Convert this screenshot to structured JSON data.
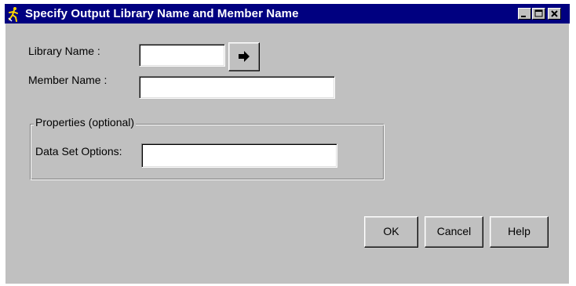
{
  "window": {
    "title": "Specify Output Library Name and Member Name",
    "title_icon": "sas-runner-icon",
    "controls": [
      "minimize-icon",
      "maximize-icon",
      "close-icon"
    ]
  },
  "form": {
    "library_label": "Library Name :",
    "library_value": "",
    "browse_icon": "right-arrow-icon",
    "member_label": "Member Name :",
    "member_value": ""
  },
  "properties": {
    "group_label": "Properties (optional)",
    "options_label": "Data Set Options:",
    "options_value": ""
  },
  "buttons": {
    "ok": "OK",
    "cancel": "Cancel",
    "help": "Help"
  },
  "colors": {
    "titlebar": "#000080",
    "face": "#c0c0c0",
    "field": "#ffffff"
  }
}
